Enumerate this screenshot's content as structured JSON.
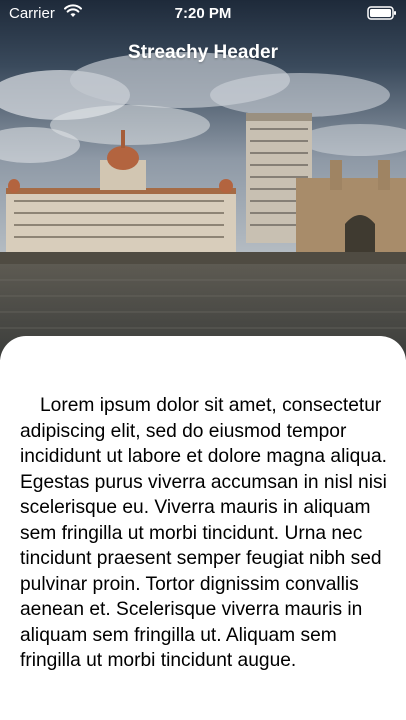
{
  "status_bar": {
    "carrier": "Carrier",
    "time": "7:20 PM",
    "wifi_icon": "wifi-icon",
    "battery_icon": "battery-icon"
  },
  "header": {
    "title": "Streachy Header",
    "image": "city-waterfront-photo"
  },
  "content": {
    "body": "Lorem ipsum dolor sit amet, consectetur adipiscing elit, sed do eiusmod tempor incididunt ut labore et dolore magna aliqua. Egestas purus viverra accumsan in nisl nisi scelerisque eu. Viverra mauris in aliquam sem fringilla ut morbi tincidunt. Urna nec tincidunt praesent semper feugiat nibh sed pulvinar proin. Tortor dignissim convallis aenean et. Scelerisque viverra mauris in aliquam sem fringilla ut. Aliquam sem fringilla ut morbi tincidunt augue."
  }
}
